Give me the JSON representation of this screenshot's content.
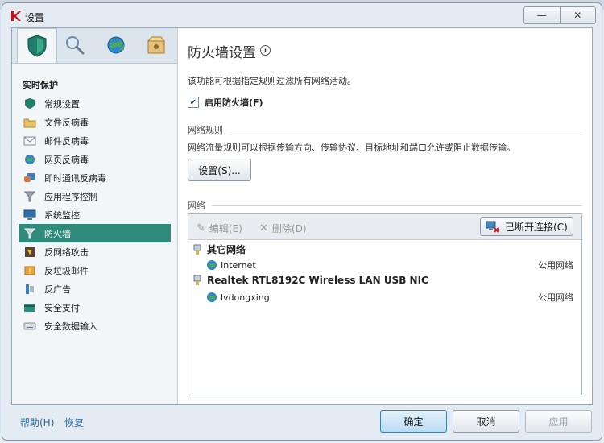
{
  "window": {
    "title": "设置",
    "minimize_label": "—",
    "close_label": "✕"
  },
  "tabs": [
    {
      "name": "protection",
      "icon": "shield-icon",
      "active": true
    },
    {
      "name": "scan",
      "icon": "magnifier-icon",
      "active": false
    },
    {
      "name": "update",
      "icon": "globe-update-icon",
      "active": false
    },
    {
      "name": "reports",
      "icon": "box-icon",
      "active": false
    }
  ],
  "sidebar": {
    "section_title": "实时保护",
    "items": [
      {
        "label": "常规设置",
        "icon": "shield-icon",
        "active": false
      },
      {
        "label": "文件反病毒",
        "icon": "folder-icon",
        "active": false
      },
      {
        "label": "邮件反病毒",
        "icon": "mail-icon",
        "active": false
      },
      {
        "label": "网页反病毒",
        "icon": "globe-icon",
        "active": false
      },
      {
        "label": "即时通讯反病毒",
        "icon": "chat-icon",
        "active": false
      },
      {
        "label": "应用程序控制",
        "icon": "filter-icon",
        "active": false
      },
      {
        "label": "系统监控",
        "icon": "monitor-icon",
        "active": false
      },
      {
        "label": "防火墙",
        "icon": "firewall-icon",
        "active": true
      },
      {
        "label": "反网络攻击",
        "icon": "attack-icon",
        "active": false
      },
      {
        "label": "反垃圾邮件",
        "icon": "spam-icon",
        "active": false
      },
      {
        "label": "反广告",
        "icon": "ad-icon",
        "active": false
      },
      {
        "label": "安全支付",
        "icon": "card-icon",
        "active": false
      },
      {
        "label": "安全数据输入",
        "icon": "keyboard-icon",
        "active": false
      }
    ]
  },
  "main": {
    "title": "防火墙设置",
    "description": "该功能可根据指定规则过滤所有网络活动。",
    "enable_firewall": {
      "label": "启用防火墙(F)",
      "checked": true
    },
    "rules_group": {
      "header": "网络规则",
      "description": "网络流量规则可以根据传输方向、传输协议、目标地址和端口允许或阻止数据传输。",
      "settings_button": "设置(S)..."
    },
    "network_group": {
      "header": "网络",
      "toolbar": {
        "edit": "编辑(E)",
        "delete": "删除(D)",
        "disconnected": "已断开连接(C)"
      },
      "groups": [
        {
          "name": "其它网络",
          "networks": [
            {
              "name": "Internet",
              "status": "公用网络"
            }
          ]
        },
        {
          "name": "Realtek RTL8192C Wireless LAN USB NIC",
          "networks": [
            {
              "name": "lvdongxing",
              "status": "公用网络"
            }
          ]
        }
      ]
    }
  },
  "footer": {
    "help": "帮助(H)",
    "restore": "恢复",
    "ok": "确定",
    "cancel": "取消",
    "apply": "应用"
  },
  "colors": {
    "accent": "#2f8b7c",
    "link": "#2b6a9c",
    "ok_button": "#c9e3f7"
  }
}
